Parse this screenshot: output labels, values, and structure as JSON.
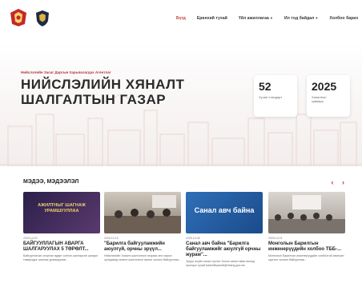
{
  "nav": {
    "items": [
      {
        "label": "Бүгд",
        "active": true
      },
      {
        "label": "Ерөнхий тухай",
        "active": false
      },
      {
        "label": "Үйл ажиллагаа",
        "dropdown": true
      },
      {
        "label": "Ил тод байдал",
        "dropdown": true
      },
      {
        "label": "Холбоо барих",
        "active": false
      }
    ]
  },
  "hero": {
    "subtitle": "Нийслэлийн Засаг Даргын Харьяалагдах Агентлаг",
    "title_line1": "НИЙСЛЭЛИЙН ХЯНАЛТ",
    "title_line2": "ШАЛГАЛТЫН ГАЗАР",
    "stats": [
      {
        "num": "52",
        "label": "Хүчин стандарт"
      },
      {
        "num": "2025",
        "label": "Хяналтын хуваарь"
      }
    ]
  },
  "news": {
    "heading": "МЭДЭЭ, МЭДЭЭЛЭЛ",
    "prev": "‹",
    "next": "›",
    "items": [
      {
        "thumb_text": "АЖИЛТНЫГ ШАГНАЖ УРАМШУУЛЛАА",
        "date": "2025.10.20",
        "title": "БАЙГУУЛЛАГЫН АВАРГА ШАЛГАРУУЛАХ 5 ТӨРӨЛТ...",
        "desc": "Байгууллагын спортын өдөрт сонгон шалгарсан шилдэг тамирчдыг шагнаж урамшуулав..."
      },
      {
        "thumb_text": "",
        "date": "2025.10.15",
        "title": "\"Барилга байгууламжийн аюулгүй, орчны эрүүл...",
        "desc": "Нийслэлийн Хяналт шалгалтын газраас энэ сарын хугацаанд хяналт шалгалтын ажлыг зохион байгууллаа..."
      },
      {
        "thumb_text": "Санал авч байна",
        "date": "2025.10.08",
        "title": "Санал авч байна \"Барилга байгууламжийг аюулгүй орчны журам\"...",
        "desc": "Эрүүл ахуйн санал хүсэлт болон санал авах ажилд оролцох тухай bairshilhyanalt@nhshg.gov.mn"
      },
      {
        "thumb_text": "",
        "date": "2025.10.01",
        "title": "Монголын Барилгын инженерүүдийн холбоо ТББ-...",
        "desc": "Монголын Барилгын инженерүүдийн холбоотой хамтран сургалт зохион байгууллаа..."
      }
    ]
  },
  "colors": {
    "accent": "#c0392b",
    "card1": "#3a2a5a",
    "card3": "#2f6fb8"
  }
}
